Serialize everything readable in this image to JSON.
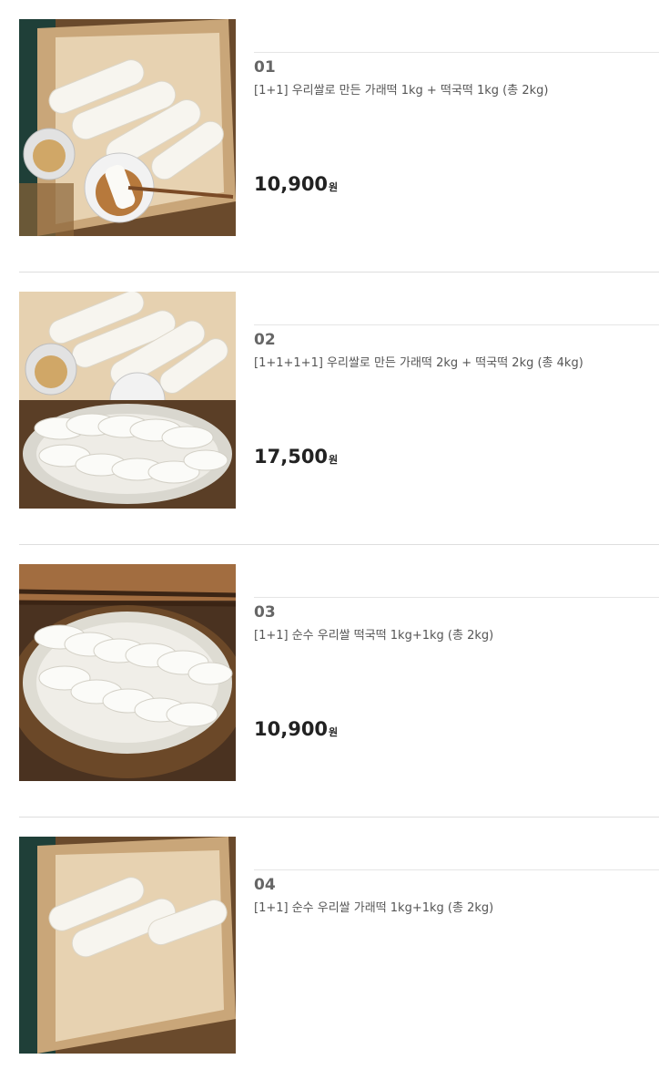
{
  "products": [
    {
      "num": "01",
      "name": "[1+1] 우리쌀로 만든 가래떡 1kg + 떡국떡 1kg (총 2kg)",
      "price": "10,900",
      "unit": "원",
      "image": "garaetteok-basket-photo"
    },
    {
      "num": "02",
      "name": "[1+1+1+1] 우리쌀로 만든 가래떡 2kg + 떡국떡 2kg (총 4kg)",
      "price": "17,500",
      "unit": "원",
      "image": "garaetteok-and-tteokguk-photo"
    },
    {
      "num": "03",
      "name": "[1+1] 순수 우리쌀 떡국떡 1kg+1kg (총 2kg)",
      "price": "10,900",
      "unit": "원",
      "image": "tteokguk-plate-photo"
    },
    {
      "num": "04",
      "name": "[1+1] 순수 우리쌀 가래떡 1kg+1kg (총 2kg)",
      "price": "",
      "unit": "",
      "image": "garaetteok-basket-photo"
    }
  ]
}
